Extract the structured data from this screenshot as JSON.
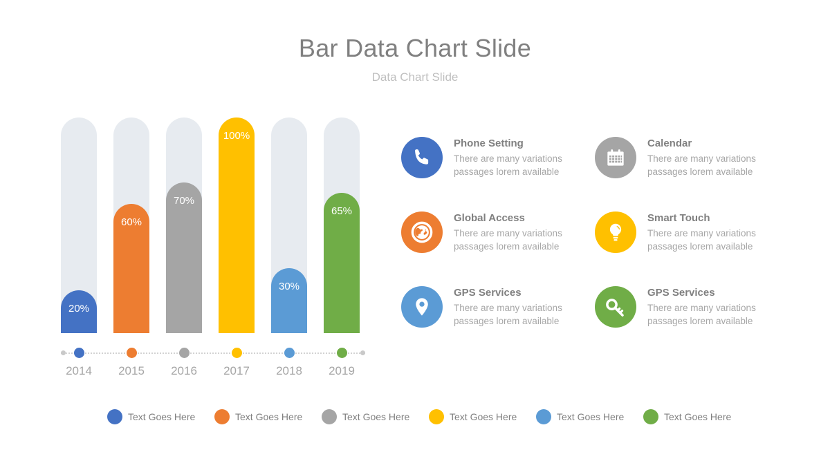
{
  "header": {
    "title": "Bar Data Chart Slide",
    "subtitle": "Data Chart Slide"
  },
  "chart_data": {
    "type": "bar",
    "title": "Bar Data Chart Slide",
    "subtitle": "Data Chart Slide",
    "xlabel": "",
    "ylabel": "",
    "ylim": [
      0,
      100
    ],
    "grid": false,
    "categories": [
      "2014",
      "2015",
      "2016",
      "2017",
      "2018",
      "2019"
    ],
    "values": [
      20,
      60,
      70,
      100,
      30,
      65
    ],
    "value_labels": [
      "20%",
      "60%",
      "70%",
      "100%",
      "30%",
      "65%"
    ],
    "colors": [
      "#4472C4",
      "#ED7D31",
      "#A5A5A5",
      "#FFC000",
      "#5B9BD5",
      "#70AD47"
    ],
    "track_color": "#E7EBF0",
    "legend_position": "bottom"
  },
  "axis": {
    "ticks": [
      "2014",
      "2015",
      "2016",
      "2017",
      "2018",
      "2019"
    ],
    "dot_colors": [
      "#4472C4",
      "#ED7D31",
      "#A5A5A5",
      "#FFC000",
      "#5B9BD5",
      "#70AD47"
    ],
    "cap_color": "#C9C9C9"
  },
  "legend": {
    "items": [
      {
        "label": "Text Goes Here",
        "color": "#4472C4"
      },
      {
        "label": "Text Goes Here",
        "color": "#ED7D31"
      },
      {
        "label": "Text Goes Here",
        "color": "#A5A5A5"
      },
      {
        "label": "Text Goes Here",
        "color": "#FFC000"
      },
      {
        "label": "Text Goes Here",
        "color": "#5B9BD5"
      },
      {
        "label": "Text Goes Here",
        "color": "#70AD47"
      }
    ]
  },
  "features": [
    {
      "title": "Phone Setting",
      "line1": "There are many variations",
      "line2": "passages lorem available",
      "icon": "phone-icon",
      "color": "#4472C4"
    },
    {
      "title": "Calendar",
      "line1": "There are many variations",
      "line2": "passages lorem available",
      "icon": "calendar-icon",
      "color": "#A5A5A5"
    },
    {
      "title": "Global Access",
      "line1": "There are many variations",
      "line2": "passages lorem available",
      "icon": "globe-icon",
      "color": "#ED7D31"
    },
    {
      "title": "Smart Touch",
      "line1": "There are many variations",
      "line2": "passages lorem available",
      "icon": "lightbulb-icon",
      "color": "#FFC000"
    },
    {
      "title": "GPS Services",
      "line1": "There are many variations",
      "line2": "passages lorem available",
      "icon": "map-pin-icon",
      "color": "#5B9BD5"
    },
    {
      "title": "GPS Services",
      "line1": "There are many variations",
      "line2": "passages lorem available",
      "icon": "key-icon",
      "color": "#70AD47"
    }
  ]
}
